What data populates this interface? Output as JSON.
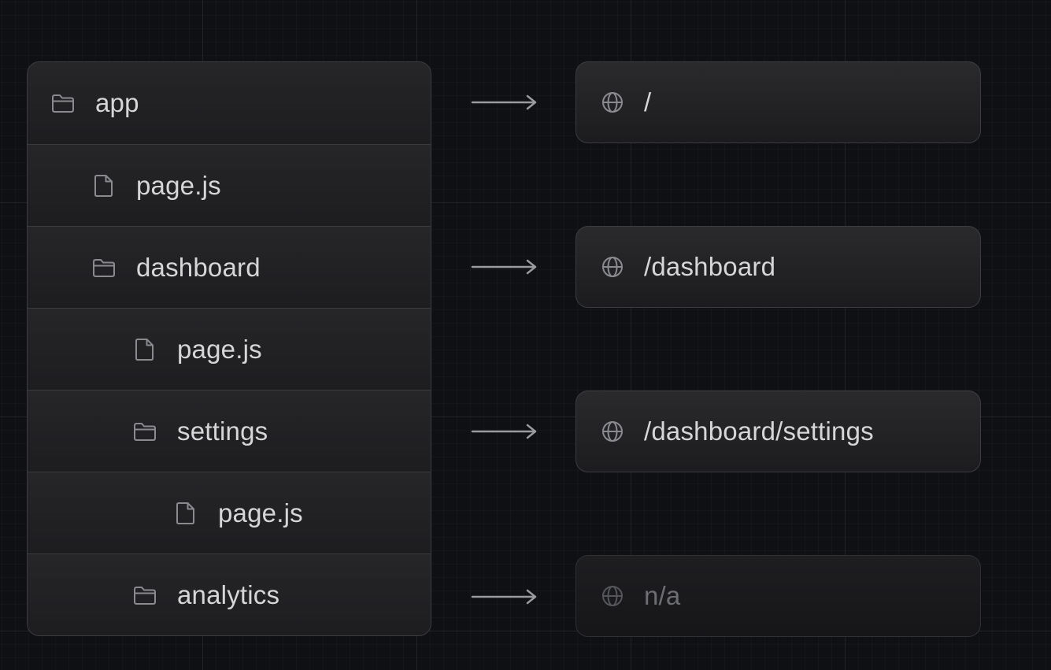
{
  "tree": {
    "items": [
      {
        "label": "app",
        "icon": "folder-icon",
        "depth": 0
      },
      {
        "label": "page.js",
        "icon": "file-icon",
        "depth": 1
      },
      {
        "label": "dashboard",
        "icon": "folder-icon",
        "depth": 1
      },
      {
        "label": "page.js",
        "icon": "file-icon",
        "depth": 2
      },
      {
        "label": "settings",
        "icon": "folder-icon",
        "depth": 2
      },
      {
        "label": "page.js",
        "icon": "file-icon",
        "depth": 3
      },
      {
        "label": "analytics",
        "icon": "folder-icon",
        "depth": 2
      }
    ]
  },
  "routes": [
    {
      "label": "/",
      "icon": "globe-icon",
      "source": "app"
    },
    {
      "label": "/dashboard",
      "icon": "globe-icon",
      "source": "dashboard"
    },
    {
      "label": "/dashboard/settings",
      "icon": "globe-icon",
      "source": "settings"
    },
    {
      "label": "n/a",
      "icon": "globe-icon",
      "source": "analytics",
      "muted": true
    }
  ],
  "colors": {
    "background": "#0f1013",
    "panel": "#1d1d20",
    "border": "#3c3d41",
    "text": "#d6d6d8",
    "muted_text": "#6d6e72",
    "icon": "#8a8b8f",
    "arrow": "#9a9b9f"
  }
}
